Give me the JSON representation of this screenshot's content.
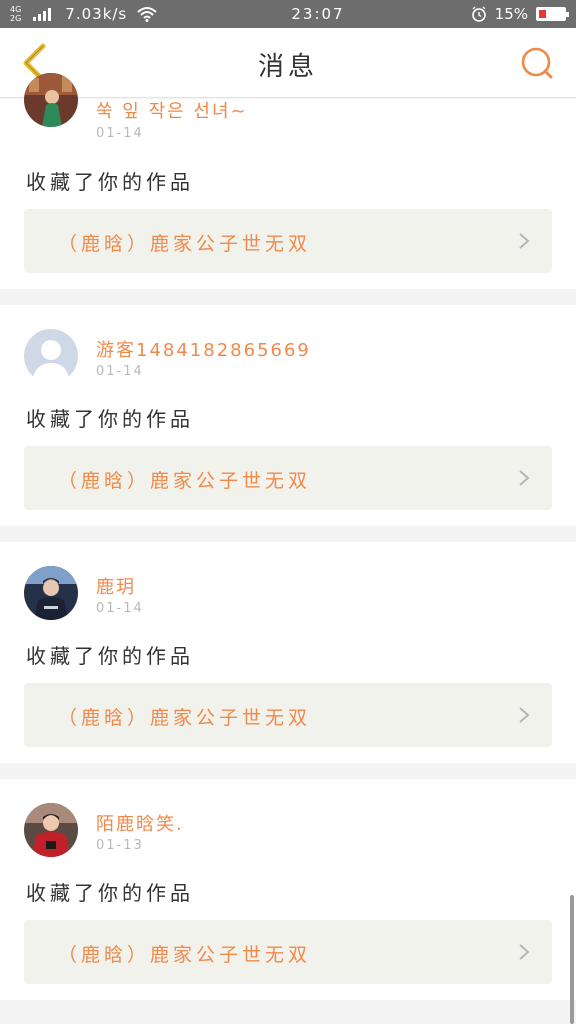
{
  "status_bar": {
    "network_top": "4G",
    "network_bottom": "2G",
    "speed": "7.03k/s",
    "time": "23:07",
    "battery": "15%"
  },
  "header": {
    "title": "消息",
    "back_icon": "chevron-left-icon",
    "search_icon": "search-icon"
  },
  "colors": {
    "accent": "#f08a4b",
    "back_arrow": "#e6b830",
    "card_bg": "#f2f2ec",
    "battery_low": "#e53935"
  },
  "messages": [
    {
      "user": "쑥 잎 작은 선녀~",
      "time": "01-14",
      "action": "收藏了你的作品",
      "work": "（鹿晗）鹿家公子世无双",
      "avatar": "avatar-green-dress"
    },
    {
      "user": "游客1484182865669",
      "time": "01-14",
      "action": "收藏了你的作品",
      "work": "（鹿晗）鹿家公子世无双",
      "avatar": "default-avatar-icon"
    },
    {
      "user": "鹿玥",
      "time": "01-14",
      "action": "收藏了你的作品",
      "work": "（鹿晗）鹿家公子世无双",
      "avatar": "avatar-dark-blue"
    },
    {
      "user": "陌鹿晗笑.",
      "time": "01-13",
      "action": "收藏了你的作品",
      "work": "（鹿晗）鹿家公子世无双",
      "avatar": "avatar-red-shirt"
    }
  ]
}
